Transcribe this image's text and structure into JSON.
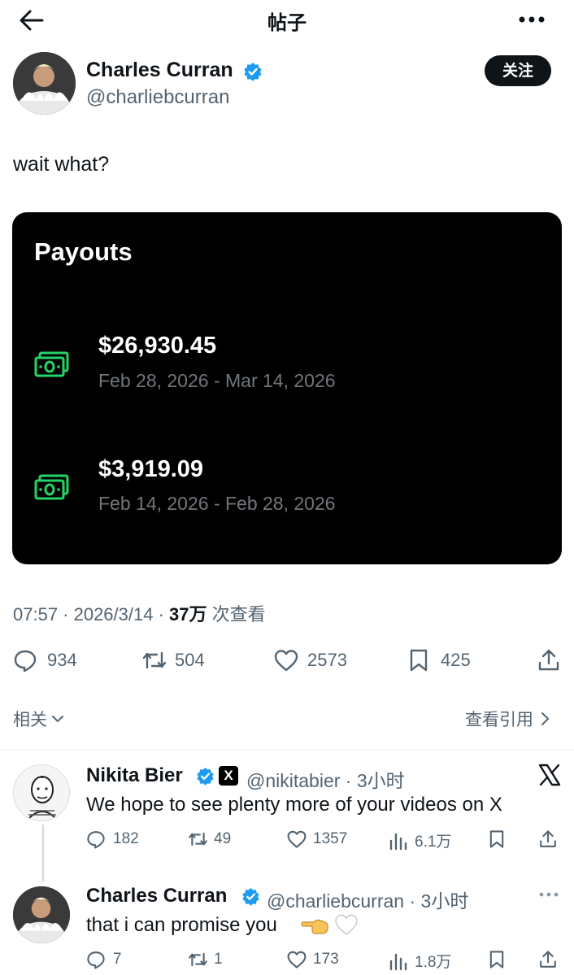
{
  "topbar": {
    "title": "帖子"
  },
  "post": {
    "author_name": "Charles Curran",
    "author_handle": "@charliebcurran",
    "follow_label": "关注",
    "text": "wait what?",
    "card": {
      "title": "Payouts",
      "payouts": [
        {
          "amount": "$26,930.45",
          "range": "Feb 28, 2026 - Mar 14, 2026"
        },
        {
          "amount": "$3,919.09",
          "range": "Feb 14, 2026 - Feb 28, 2026"
        }
      ]
    },
    "meta": {
      "time_date": "07:57 · 2026/3/14 · ",
      "views_count": "37万",
      "views_label": " 次查看"
    },
    "actions": {
      "replies": "934",
      "retweets": "504",
      "likes": "2573",
      "bookmarks": "425"
    }
  },
  "related": {
    "label": "相关",
    "view_quotes": "查看引用"
  },
  "replies": [
    {
      "name": "Nikita Bier",
      "badge": "X",
      "handle_time": "@nikitabier · 3小时",
      "text": "We hope to see plenty more of your videos on X",
      "replies": "182",
      "retweets": "49",
      "likes": "1357",
      "views": "6.1万"
    },
    {
      "name": "Charles Curran",
      "handle_time": "@charliebcurran · 3小时",
      "text": "that i can promise you",
      "replies": "7",
      "retweets": "1",
      "likes": "173",
      "views": "1.8万"
    }
  ],
  "colors": {
    "text": "#0f1419",
    "muted": "#536471",
    "verified": "#1d9bf0",
    "cash_green": "#25d366",
    "card_bg": "#000000"
  },
  "icons": [
    "back-arrow-icon",
    "more-icon",
    "verified-icon",
    "cash-icon",
    "reply-icon",
    "retweet-icon",
    "like-icon",
    "bookmark-icon",
    "share-icon",
    "views-icon",
    "chevron-down-icon",
    "chevron-right-icon",
    "x-logo-icon",
    "pointing-left-emoji",
    "white-heart-emoji"
  ]
}
